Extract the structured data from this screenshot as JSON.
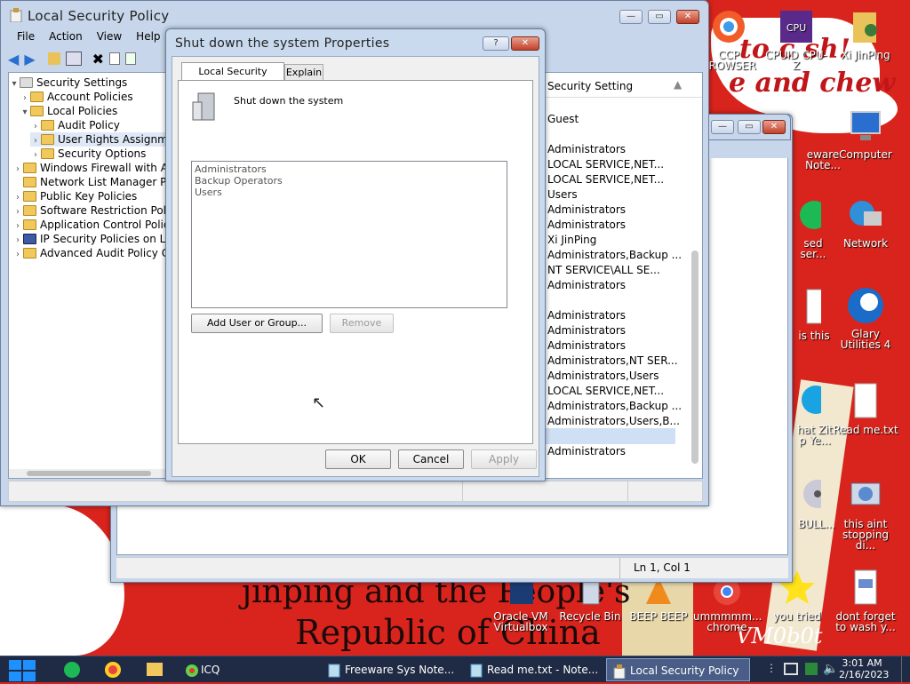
{
  "wallpaper": {
    "line1": "to c sh!",
    "line2": "e and chew",
    "line3": "jinping and the People's",
    "line4": "Republic of China",
    "watermark": "VM0b0t"
  },
  "desktop_icons": [
    {
      "label": "CCP BROWSER",
      "icon": "browser-icon"
    },
    {
      "label": "CPUID CPU-Z",
      "icon": "cpuz-icon"
    },
    {
      "label": "Xi JinPing",
      "icon": "folder-user-icon"
    },
    {
      "label": "eware Note...",
      "icon": "notepad-icon"
    },
    {
      "label": "Computer",
      "icon": "computer-icon"
    },
    {
      "label": "sed ser...",
      "icon": "spotify-icon"
    },
    {
      "label": "Network",
      "icon": "network-icon"
    },
    {
      "label": "is this",
      "icon": "document-icon"
    },
    {
      "label": "Glary Utilities 4",
      "icon": "glary-icon"
    },
    {
      "label": "hat Zit p Ye...",
      "icon": "skype-icon"
    },
    {
      "label": "Read me.txt",
      "icon": "text-file-icon"
    },
    {
      "label": "BULL...",
      "icon": "disc-icon"
    },
    {
      "label": "this aint stopping di...",
      "icon": "installer-icon"
    },
    {
      "label": "Oracle VM Virtualbox",
      "icon": "virtualbox-icon"
    },
    {
      "label": "Recycle Bin",
      "icon": "recycle-bin-icon"
    },
    {
      "label": "BEEP BEEP",
      "icon": "vlc-icon"
    },
    {
      "label": "ummmmm... chrome",
      "icon": "chrome-icon"
    },
    {
      "label": "you tried",
      "icon": "star-icon"
    },
    {
      "label": "dont forget to wash y...",
      "icon": "document-icon"
    }
  ],
  "lsp": {
    "title": "Local Security Policy",
    "menu": [
      "File",
      "Action",
      "View",
      "Help"
    ],
    "tree": [
      {
        "label": "Security Settings",
        "expanded": true
      },
      {
        "label": "Account Policies",
        "expanded": false
      },
      {
        "label": "Local Policies",
        "expanded": true
      },
      {
        "label": "Audit Policy",
        "expanded": false
      },
      {
        "label": "User Rights Assignm",
        "expanded": true,
        "selected": true
      },
      {
        "label": "Security Options",
        "expanded": false
      },
      {
        "label": "Windows Firewall with Ac",
        "expanded": false
      },
      {
        "label": "Network List Manager P",
        "expanded": false
      },
      {
        "label": "Public Key Policies",
        "expanded": false
      },
      {
        "label": "Software Restriction Pol",
        "expanded": false
      },
      {
        "label": "Application Control Polici",
        "expanded": false
      },
      {
        "label": "IP Security Policies on Lo",
        "expanded": false
      },
      {
        "label": "Advanced Audit Policy C",
        "expanded": false
      }
    ],
    "column_header": "Security Setting",
    "settings": [
      "Guest",
      "",
      "Administrators",
      "LOCAL SERVICE,NET...",
      "LOCAL SERVICE,NET...",
      "Users",
      "Administrators",
      "Administrators",
      "Xi JinPing",
      "Administrators,Backup ...",
      "NT SERVICE\\ALL SE...",
      "Administrators",
      "",
      "Administrators",
      "Administrators",
      "Administrators",
      "Administrators,NT SER...",
      "Administrators,Users",
      "LOCAL SERVICE,NET...",
      "Administrators,Backup ...",
      "Administrators,Users,B...",
      "",
      "Administrators"
    ]
  },
  "notepad": {
    "status": "Ln 1, Col 1"
  },
  "dialog": {
    "title": "Shut down the system Properties",
    "help": "?",
    "tabs": [
      "Local Security Setting",
      "Explain"
    ],
    "policy_name": "Shut down the system",
    "members": [
      "Administrators",
      "Backup Operators",
      "Users"
    ],
    "add_button": "Add User or Group...",
    "remove_button": "Remove",
    "ok": "OK",
    "cancel": "Cancel",
    "apply": "Apply"
  },
  "taskbar": {
    "tasks": [
      {
        "label": "ICQ",
        "icon": "icq-icon",
        "active": false
      },
      {
        "label": "Freeware Sys Note...",
        "icon": "notepad-icon",
        "active": false
      },
      {
        "label": "Read me.txt - Note...",
        "icon": "notepad-icon",
        "active": false
      },
      {
        "label": "Local Security Policy",
        "icon": "security-policy-icon",
        "active": true
      }
    ],
    "time": "3:01 AM",
    "date": "2/16/2023"
  },
  "colors": {
    "wallpaper_red": "#d8241c",
    "taskbar": "#1f2a44",
    "window_frame": "#c7d6ea",
    "selection": "#cfe0f5"
  }
}
